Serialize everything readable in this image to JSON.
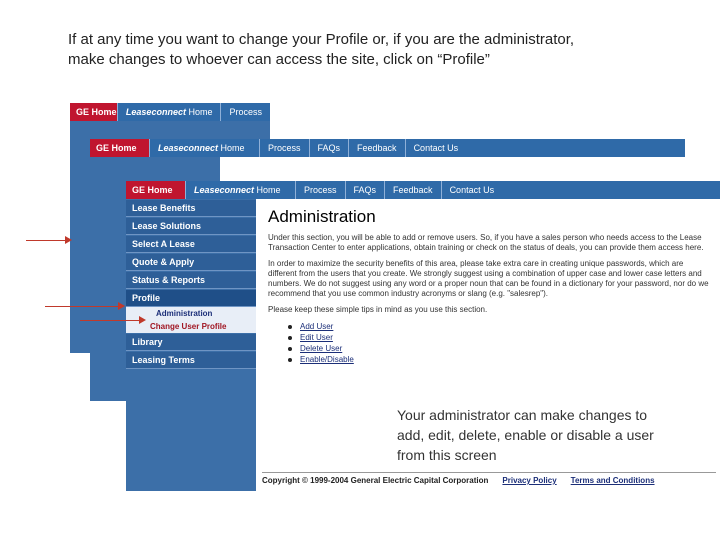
{
  "caption": {
    "line1": "If at any time you want to change your Profile or, if you are the administrator,",
    "line2": "make changes to whoever can access the site, click on “Profile”"
  },
  "nav": {
    "home": "GE Home",
    "brand": "Leaseconnect",
    "home_label": "Home",
    "process": "Process",
    "faqs": "FAQs",
    "feedback": "Feedback",
    "contact": "Contact Us"
  },
  "sidebar": {
    "lease_benefits": "Lease Benefits",
    "lease_solutions": "Lease Solutions",
    "select_a_lease": "Select A Lease",
    "status": "Status & Reports",
    "quote": "Quote & Apply",
    "profile": "Profile",
    "administration": "Administration",
    "change_user_profile": "Change User Profile",
    "library": "Library",
    "leasing_terms": "Leasing Terms"
  },
  "content": {
    "title": "Administration",
    "para1": "Under this section, you will be able to add or remove users. So, if you have a sales person who needs access to the Lease Transaction Center to enter applications, obtain training or check on the status of deals, you can provide them access here.",
    "para2": "In order to maximize the security benefits of this area, please take extra care in creating unique passwords, which are different from the users that you create. We strongly suggest using a combination of upper case and lower case letters and numbers. We do not suggest using any word or a proper noun that can be found in a dictionary for your password, nor do we recommend that you use common industry acronyms or slang (e.g. \"salesrep\").",
    "para3": "Please keep these simple tips in mind as you use this section.",
    "links": [
      "Add User",
      "Edit User",
      "Delete User",
      "Enable/Disable"
    ]
  },
  "footer": {
    "copyright": "Copyright © 1999-2004 General Electric Capital Corporation",
    "privacy": "Privacy Policy",
    "terms": "Terms and Conditions"
  },
  "annotation": {
    "line1": "Your administrator can make changes to",
    "line2": "add, edit, delete, enable or disable a user",
    "line3": "from this screen"
  },
  "colors": {
    "nav_blue": "#2f6aa8",
    "home_red": "#c0152f",
    "arrow_red": "#c0392b"
  }
}
